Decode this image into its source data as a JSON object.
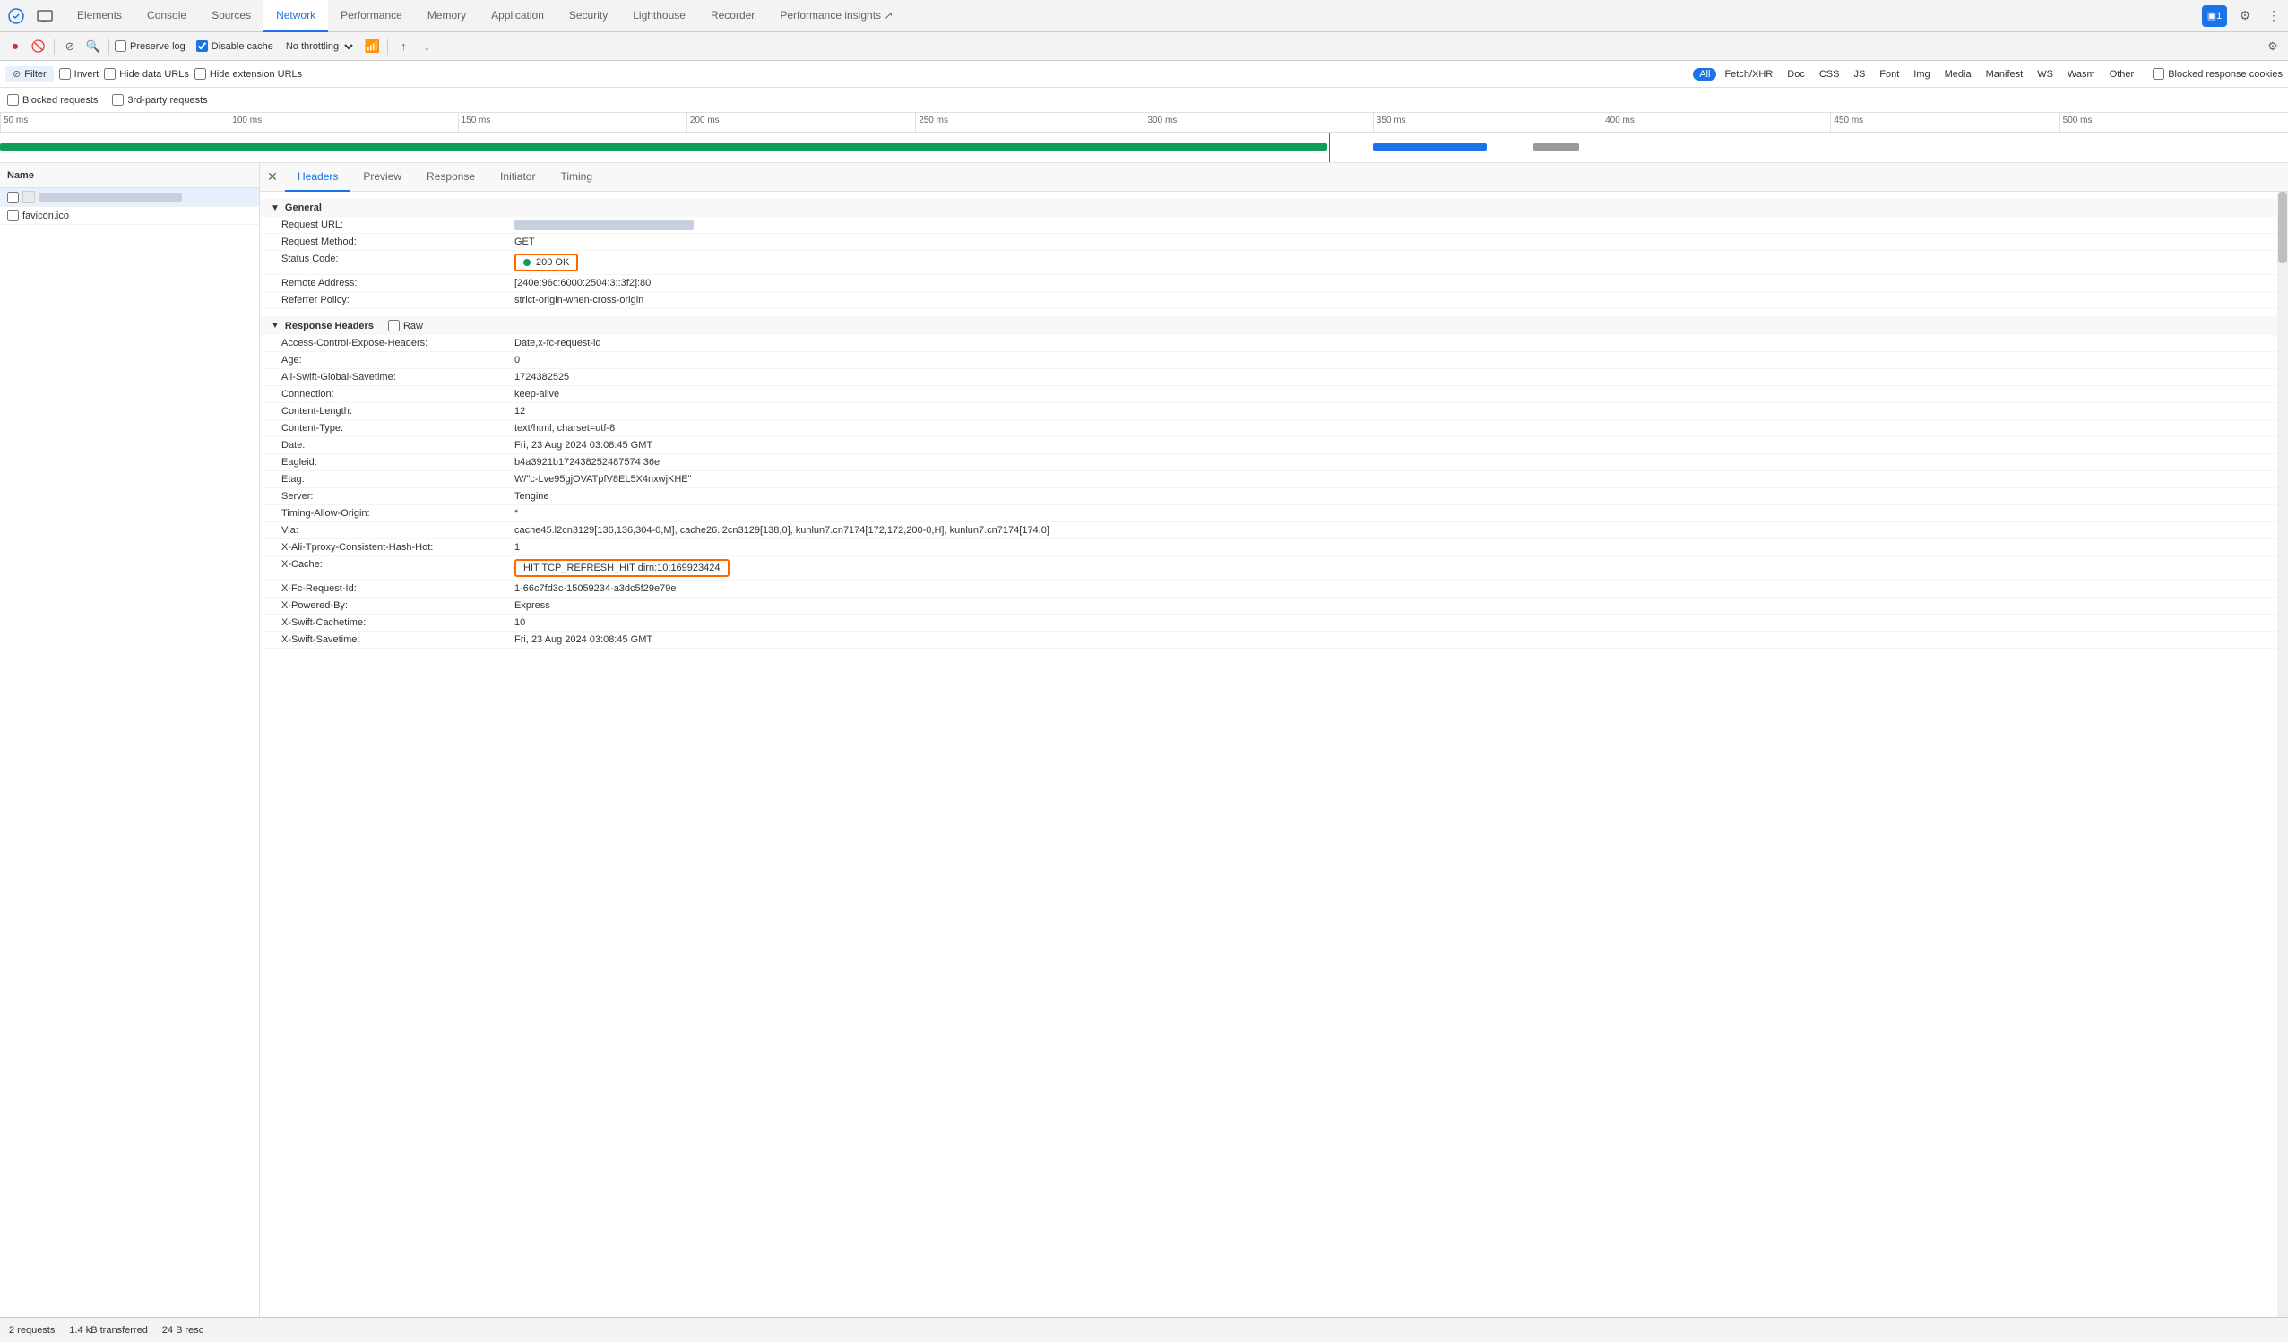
{
  "devtools": {
    "tabs": [
      {
        "label": "Elements",
        "active": false
      },
      {
        "label": "Console",
        "active": false
      },
      {
        "label": "Sources",
        "active": false
      },
      {
        "label": "Network",
        "active": true
      },
      {
        "label": "Performance",
        "active": false
      },
      {
        "label": "Memory",
        "active": false
      },
      {
        "label": "Application",
        "active": false
      },
      {
        "label": "Security",
        "active": false
      },
      {
        "label": "Lighthouse",
        "active": false
      },
      {
        "label": "Recorder",
        "active": false
      },
      {
        "label": "Performance insights ↗",
        "active": false
      }
    ],
    "badge": "1",
    "settings_icon": "⚙",
    "more_icon": "⋮"
  },
  "network_toolbar": {
    "record_stop": "⏺",
    "clear": "🚫",
    "filter_icon": "⊘",
    "search_icon": "🔍",
    "preserve_log_label": "Preserve log",
    "disable_cache_label": "Disable cache",
    "throttle_label": "No throttling",
    "import_icon": "↑",
    "export_icon": "↓",
    "settings_icon": "⚙"
  },
  "filter_toolbar": {
    "filter_label": "Filter",
    "invert_label": "Invert",
    "hide_data_urls_label": "Hide data URLs",
    "hide_ext_urls_label": "Hide extension URLs",
    "chips": [
      {
        "label": "All",
        "active": true
      },
      {
        "label": "Fetch/XHR",
        "active": false
      },
      {
        "label": "Doc",
        "active": false
      },
      {
        "label": "CSS",
        "active": false
      },
      {
        "label": "JS",
        "active": false
      },
      {
        "label": "Font",
        "active": false
      },
      {
        "label": "Img",
        "active": false
      },
      {
        "label": "Media",
        "active": false
      },
      {
        "label": "Manifest",
        "active": false
      },
      {
        "label": "WS",
        "active": false
      },
      {
        "label": "Wasm",
        "active": false
      },
      {
        "label": "Other",
        "active": false
      }
    ],
    "blocked_cookies_label": "Blocked response cookies"
  },
  "blocked_toolbar": {
    "blocked_requests_label": "Blocked requests",
    "third_party_label": "3rd-party requests"
  },
  "timeline": {
    "ticks": [
      "50 ms",
      "100 ms",
      "150 ms",
      "200 ms",
      "250 ms",
      "300 ms",
      "350 ms",
      "400 ms",
      "450 ms",
      "500 ms"
    ]
  },
  "left_panel": {
    "name_header": "Name",
    "requests": [
      {
        "name": "blurred_main",
        "blurred": true,
        "selected": true
      },
      {
        "name": "favicon.ico",
        "blurred": false,
        "selected": false
      }
    ]
  },
  "panel_tabs": {
    "headers_label": "Headers",
    "preview_label": "Preview",
    "response_label": "Response",
    "initiator_label": "Initiator",
    "timing_label": "Timing",
    "active": "Headers"
  },
  "headers": {
    "general_section": "General",
    "request_url_label": "Request URL:",
    "request_url_value": "blurred_value",
    "request_method_label": "Request Method:",
    "request_method_value": "GET",
    "status_code_label": "Status Code:",
    "status_code_value": "200 OK",
    "remote_address_label": "Remote Address:",
    "remote_address_value": "[240e:96c:6000:2504:3::3f2]:80",
    "referrer_policy_label": "Referrer Policy:",
    "referrer_policy_value": "strict-origin-when-cross-origin",
    "response_headers_section": "Response Headers",
    "raw_label": "Raw",
    "response_headers": [
      {
        "name": "Access-Control-Expose-Headers:",
        "value": "Date,x-fc-request-id"
      },
      {
        "name": "Age:",
        "value": "0"
      },
      {
        "name": "Ali-Swift-Global-Savetime:",
        "value": "1724382525"
      },
      {
        "name": "Connection:",
        "value": "keep-alive"
      },
      {
        "name": "Content-Length:",
        "value": "12"
      },
      {
        "name": "Content-Type:",
        "value": "text/html; charset=utf-8"
      },
      {
        "name": "Date:",
        "value": "Fri, 23 Aug 2024 03:08:45 GMT"
      },
      {
        "name": "Eagleid:",
        "value": "b4a3921b172438252487574 36e"
      },
      {
        "name": "Etag:",
        "value": "W/\"c-Lve95gjOVATpfV8EL5X4nxwjKHE\""
      },
      {
        "name": "Server:",
        "value": "Tengine"
      },
      {
        "name": "Timing-Allow-Origin:",
        "value": "*"
      },
      {
        "name": "Via:",
        "value": "cache45.l2cn3129[136,136,304-0,M], cache26.l2cn3129[138,0], kunlun7.cn7174[172,172,200-0,H], kunlun7.cn7174[174,0]"
      },
      {
        "name": "X-Ali-Tproxy-Consistent-Hash-Hot:",
        "value": "1"
      },
      {
        "name": "X-Cache:",
        "value": "HIT TCP_REFRESH_HIT dirn:10:169923424",
        "highlighted": true
      },
      {
        "name": "X-Fc-Request-Id:",
        "value": "1-66c7fd3c-15059234-a3dc5f29e79e"
      },
      {
        "name": "X-Powered-By:",
        "value": "Express"
      },
      {
        "name": "X-Swift-Cachetime:",
        "value": "10"
      },
      {
        "name": "X-Swift-Savetime:",
        "value": "Fri, 23 Aug 2024 03:08:45 GMT"
      }
    ]
  },
  "status_bar": {
    "requests_label": "2 requests",
    "transferred_label": "1.4 kB transferred",
    "resources_label": "24 B resc"
  }
}
